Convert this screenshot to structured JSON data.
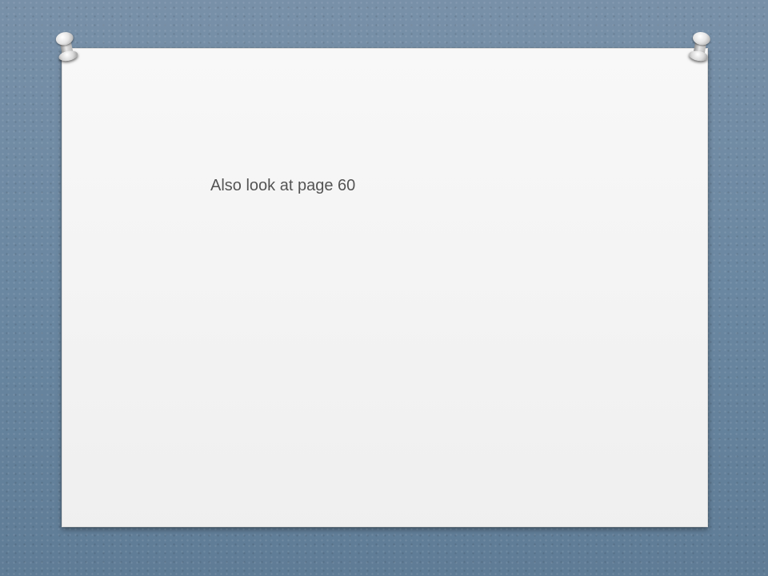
{
  "slide": {
    "body_text": "Also look at page 60"
  },
  "decorations": {
    "left_pin": "pushpin-icon",
    "right_pin": "pushpin-icon"
  },
  "colors": {
    "background": "#6e8aa3",
    "board": "#f4f4f4",
    "text": "#1a1a1a"
  }
}
